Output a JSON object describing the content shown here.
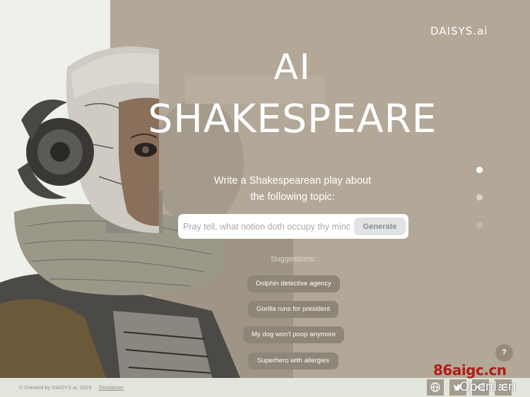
{
  "brand": {
    "logo_text": "DAISYS.ai"
  },
  "hero": {
    "title_line1": "AI",
    "title_line2": "SHAKESPEARE"
  },
  "prompt": {
    "line1": "Write a Shakespearean play about",
    "line2": "the following topic:",
    "input_value": "",
    "input_placeholder": "Pray tell, what notion doth occupy thy mind?",
    "generate_label": "Generate"
  },
  "suggestions": {
    "label": "Suggestions:",
    "items": [
      "Dolphin detective agency",
      "Gorilla runs for president",
      "My dog won't poop anymore",
      "Superhero with allergies"
    ]
  },
  "help": {
    "label": "?"
  },
  "footer": {
    "copyright": "© Created by DAISYS.ai, 2023",
    "disclaimer": "Disclaimer"
  },
  "icons": [
    "globe-icon",
    "twitter-icon",
    "share-icon",
    "menu-icon"
  ],
  "watermark": {
    "text1": "86aigc.cn",
    "text2": "Openl.cn"
  },
  "colors": {
    "background_left": "#eef1ea",
    "background_right": "#b3a898",
    "chip": "#8e8678",
    "footer": "#e2e5db",
    "watermark": "#b11c17"
  }
}
